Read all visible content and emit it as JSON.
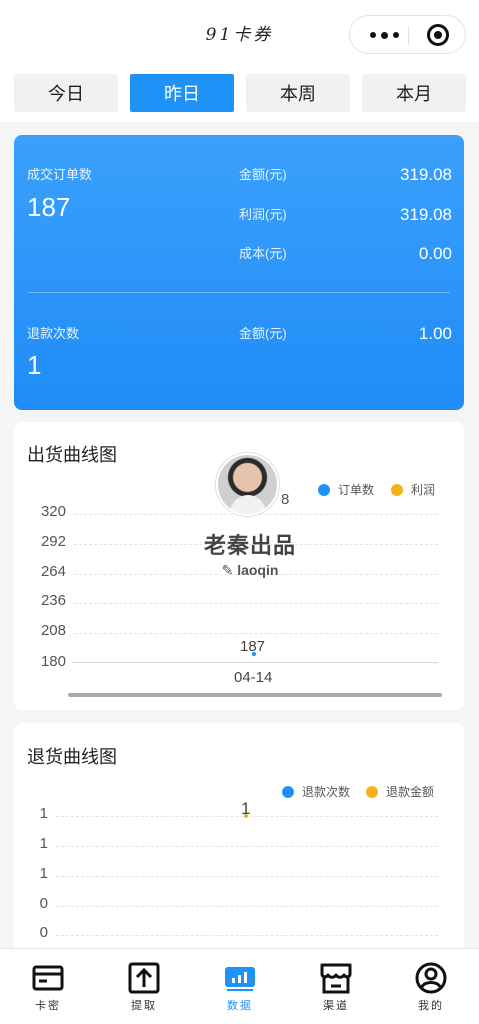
{
  "header": {
    "title": "91卡券"
  },
  "date_tabs": [
    {
      "label": "今日"
    },
    {
      "label": "昨日",
      "active": true
    },
    {
      "label": "本周"
    },
    {
      "label": "本月"
    }
  ],
  "summary": {
    "orders_label": "成交订单数",
    "orders_value": "187",
    "amount_label": "金额(元)",
    "amount_value": "319.08",
    "profit_label": "利润(元)",
    "profit_value": "319.08",
    "cost_label": "成本(元)",
    "cost_value": "0.00",
    "refund_count_label": "退款次数",
    "refund_count_value": "1",
    "refund_amount_label": "金额(元)",
    "refund_amount_value": "1.00"
  },
  "shipment_chart": {
    "title": "出货曲线图",
    "legend": [
      {
        "name": "订单数",
        "color": "#1f92f7"
      },
      {
        "name": "利润",
        "color": "#f5b31b"
      }
    ],
    "y_ticks": [
      "320",
      "292",
      "264",
      "236",
      "208",
      "180"
    ],
    "x_ticks": [
      "04-14"
    ],
    "point_label": "187",
    "overlapped_label": "8"
  },
  "refund_chart": {
    "title": "退货曲线图",
    "legend": [
      {
        "name": "退款次数",
        "color": "#1f92f7"
      },
      {
        "name": "退款金额",
        "color": "#f5b31b"
      }
    ],
    "y_ticks": [
      "1",
      "1",
      "1",
      "0",
      "0"
    ],
    "point_label": "1"
  },
  "chart_data": [
    {
      "type": "line",
      "title": "出货曲线图",
      "categories": [
        "04-14"
      ],
      "series": [
        {
          "name": "订单数",
          "values": [
            187
          ]
        },
        {
          "name": "利润",
          "values": [
            319.08
          ]
        }
      ],
      "ylim": [
        180,
        320
      ]
    },
    {
      "type": "line",
      "title": "退货曲线图",
      "categories": [
        "04-14"
      ],
      "series": [
        {
          "name": "退款次数",
          "values": [
            1
          ]
        },
        {
          "name": "退款金额",
          "values": [
            1
          ]
        }
      ]
    }
  ],
  "watermark": {
    "title": "老秦出品",
    "handle": "laoqin"
  },
  "tabbar": {
    "items": [
      {
        "label": "卡密",
        "icon": "card-icon"
      },
      {
        "label": "提取",
        "icon": "upload-icon"
      },
      {
        "label": "数据",
        "icon": "chart-icon",
        "active": true
      },
      {
        "label": "渠道",
        "icon": "store-icon"
      },
      {
        "label": "我的",
        "icon": "profile-icon"
      }
    ],
    "active_color": "#1f92f7"
  }
}
